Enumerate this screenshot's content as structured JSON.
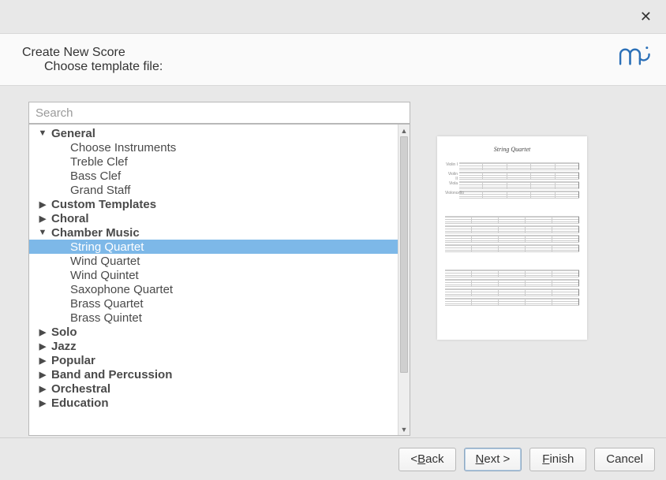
{
  "header": {
    "title": "Create New Score",
    "subtitle": "Choose template file:"
  },
  "search": {
    "placeholder": "Search"
  },
  "tree": {
    "categories": [
      {
        "label": "General",
        "expanded": true,
        "items": [
          "Choose Instruments",
          "Treble Clef",
          "Bass Clef",
          "Grand Staff"
        ]
      },
      {
        "label": "Custom Templates",
        "expanded": false,
        "items": []
      },
      {
        "label": "Choral",
        "expanded": false,
        "items": []
      },
      {
        "label": "Chamber Music",
        "expanded": true,
        "items": [
          "String Quartet",
          "Wind Quartet",
          "Wind Quintet",
          "Saxophone Quartet",
          "Brass Quartet",
          "Brass Quintet"
        ]
      },
      {
        "label": "Solo",
        "expanded": false,
        "items": []
      },
      {
        "label": "Jazz",
        "expanded": false,
        "items": []
      },
      {
        "label": "Popular",
        "expanded": false,
        "items": []
      },
      {
        "label": "Band and Percussion",
        "expanded": false,
        "items": []
      },
      {
        "label": "Orchestral",
        "expanded": false,
        "items": []
      },
      {
        "label": "Education",
        "expanded": false,
        "items": []
      }
    ],
    "selected": "String Quartet"
  },
  "preview": {
    "title": "String Quartet",
    "parts": [
      "Violin I",
      "Violin II",
      "Viola",
      "Violoncello"
    ]
  },
  "buttons": {
    "back_prefix": "< ",
    "back_accel": "B",
    "back_rest": "ack",
    "next_accel": "N",
    "next_rest": "ext >",
    "finish_accel": "F",
    "finish_rest": "inish",
    "cancel": "Cancel"
  }
}
